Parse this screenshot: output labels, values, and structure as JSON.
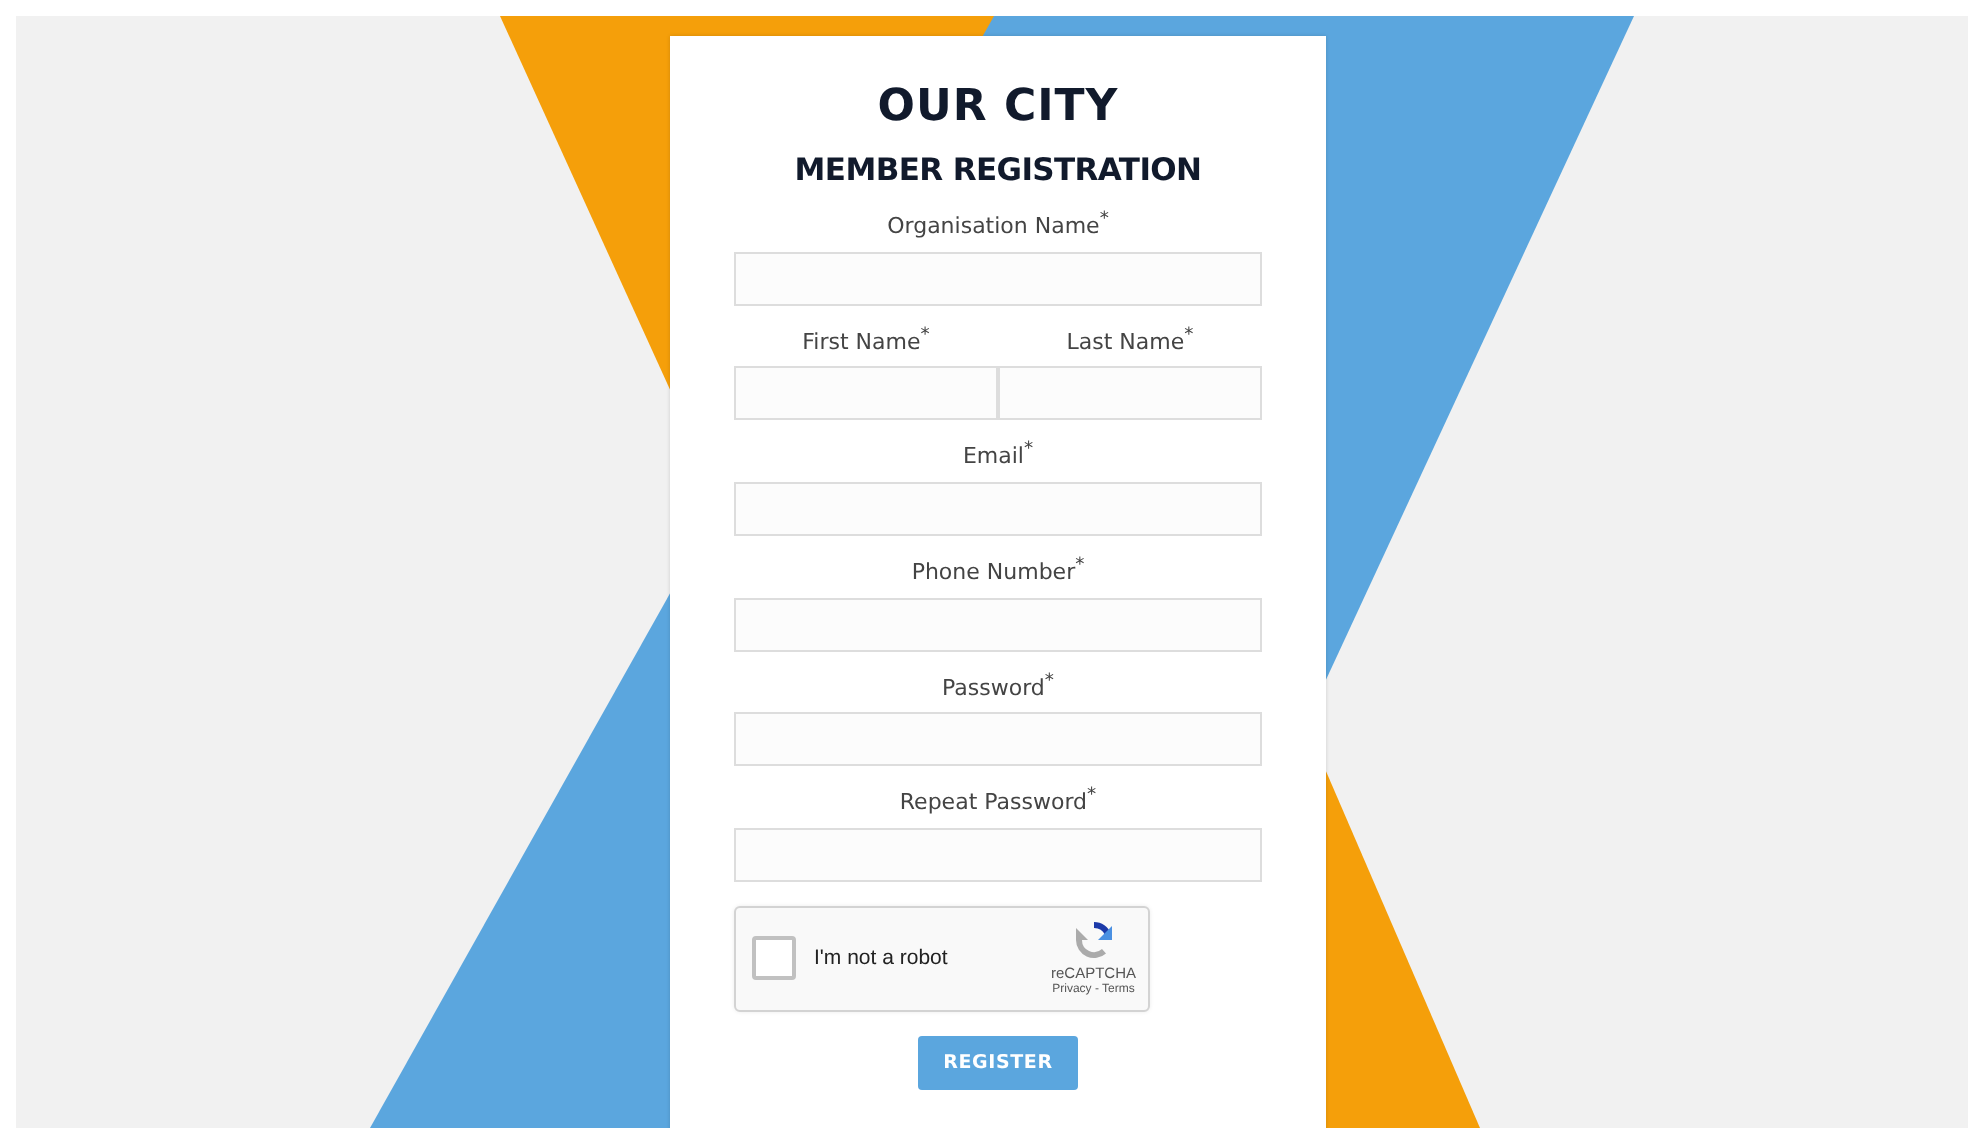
{
  "title": "OUR CITY",
  "subtitle": "MEMBER REGISTRATION",
  "rows": [
    {
      "fields": [
        {
          "label": "Organisation Name$^{*}$"
        }
      ]
    },
    {
      "fields": [
        {
          "label": "First Name$^{*}$"
        },
        {
          "label": "Last Name$^{*}$"
        }
      ]
    },
    {
      "fields": [
        {
          "label": "Email$^{*}$"
        }
      ]
    },
    {
      "fields": [
        {
          "label": "Phone Number$^{*}$"
        }
      ]
    },
    {
      "fields": [
        {
          "label": "Password$^{*}$"
        }
      ]
    },
    {
      "fields": [
        {
          "label": "Repeat Password$^{*}$"
        }
      ]
    }
  ],
  "captcha": {
    "label": "I'm not a robot",
    "checked": false,
    "brand": "reCAPTCHA",
    "links": "Privacy - Terms"
  },
  "button": "REGISTER"
}
